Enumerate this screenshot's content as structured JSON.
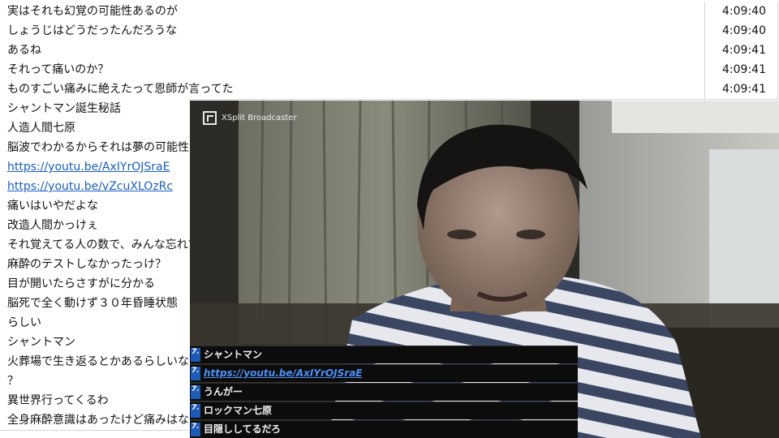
{
  "comments": [
    {
      "text": "実はそれも幻覚の可能性あるのが",
      "time": "4:09:40"
    },
    {
      "text": "しょうじはどうだったんだろうな",
      "time": "4:09:40"
    },
    {
      "text": "あるね",
      "time": "4:09:41"
    },
    {
      "text": "それって痛いのか？",
      "time": "4:09:41"
    },
    {
      "text": "ものすごい痛みに絶えたって恩師が言ってた",
      "time": "4:09:41"
    },
    {
      "text": "シャントマン誕生秘話"
    },
    {
      "text": "人造人間七原"
    },
    {
      "text": "脳波でわかるからそれは夢の可能性ない"
    },
    {
      "text": "https://youtu.be/AxIYrOJSraE",
      "link": true
    },
    {
      "text": "https://youtu.be/vZcuXLOzRc",
      "link": true
    },
    {
      "text": "痛いはいやだよな"
    },
    {
      "text": "改造人間かっけぇ"
    },
    {
      "text": "それ覚えてる人の数で、みんな忘れてる"
    },
    {
      "text": "麻酔のテストしなかったっけ？"
    },
    {
      "text": "目が開いたらさすがに分かる"
    },
    {
      "text": "脳死で全く動けず３０年昏睡状態"
    },
    {
      "text": "らしい"
    },
    {
      "text": "シャントマン"
    },
    {
      "text": "火葬場で生き返るとかあるらしいな"
    },
    {
      "text": "？"
    },
    {
      "text": "異世界行ってくるわ"
    },
    {
      "text": "全身麻酔意識はあったけど痛みはなかった"
    }
  ],
  "video": {
    "brand": "XSplit Broadcaster",
    "overlay_badge": "7.",
    "overlay": [
      {
        "text": "シャントマン"
      },
      {
        "text": "https://youtu.be/AxIYrOJSraE",
        "link": true
      },
      {
        "text": "うんがー"
      },
      {
        "text": "ロックマン七原"
      },
      {
        "text": "目隠ししてるだろ"
      }
    ]
  }
}
